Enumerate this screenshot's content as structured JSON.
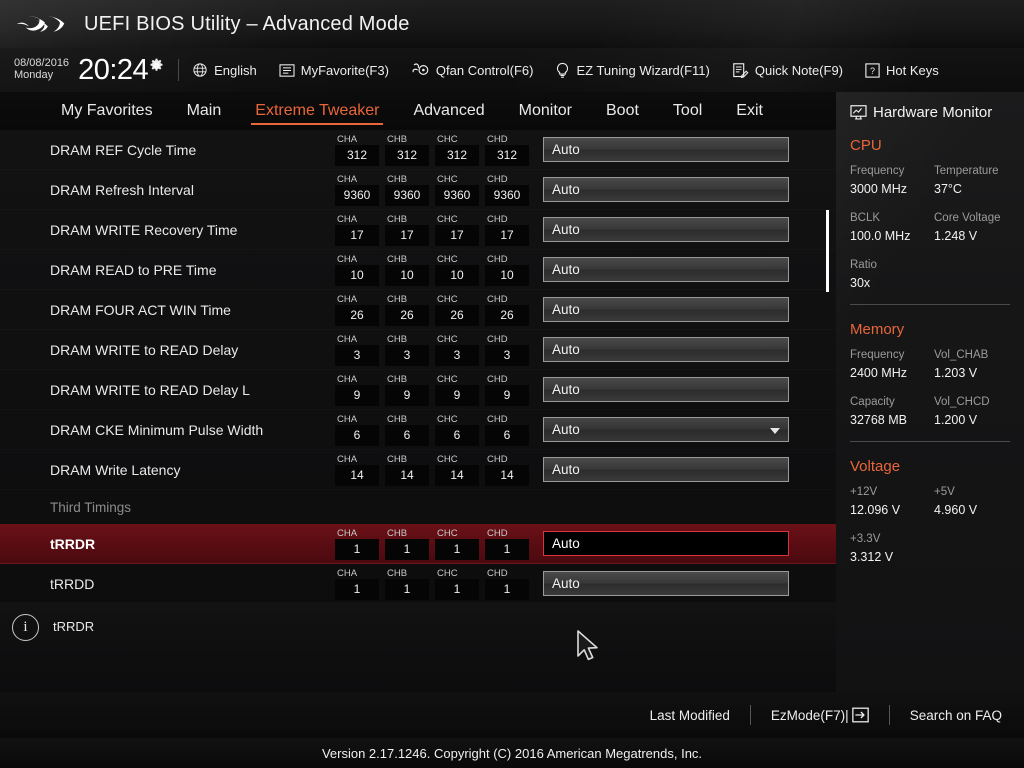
{
  "titlebar": {
    "logo_icon": "rog-logo",
    "title": "UEFI BIOS Utility – Advanced Mode"
  },
  "toolbar": {
    "date": "08/08/2016",
    "weekday": "Monday",
    "time": "20:24",
    "gear_icon": "gear-icon",
    "items": [
      {
        "icon": "globe-icon",
        "label": "English"
      },
      {
        "icon": "list-icon",
        "label": "MyFavorite(F3)"
      },
      {
        "icon": "fan-icon",
        "label": "Qfan Control(F6)"
      },
      {
        "icon": "bulb-icon",
        "label": "EZ Tuning Wizard(F11)"
      },
      {
        "icon": "note-icon",
        "label": "Quick Note(F9)"
      },
      {
        "icon": "question-icon",
        "label": "Hot Keys"
      }
    ]
  },
  "tabs": [
    {
      "label": "My Favorites",
      "active": false
    },
    {
      "label": "Main",
      "active": false
    },
    {
      "label": "Extreme Tweaker",
      "active": true
    },
    {
      "label": "Advanced",
      "active": false
    },
    {
      "label": "Monitor",
      "active": false
    },
    {
      "label": "Boot",
      "active": false
    },
    {
      "label": "Tool",
      "active": false
    },
    {
      "label": "Exit",
      "active": false
    }
  ],
  "channel_headers": [
    "CHA",
    "CHB",
    "CHC",
    "CHD"
  ],
  "settings": [
    {
      "type": "setting",
      "label": "DRAM REF Cycle Time",
      "channels": [
        "312",
        "312",
        "312",
        "312"
      ],
      "value": "Auto",
      "control": "text",
      "selected": false
    },
    {
      "type": "setting",
      "label": "DRAM Refresh Interval",
      "channels": [
        "9360",
        "9360",
        "9360",
        "9360"
      ],
      "value": "Auto",
      "control": "text",
      "selected": false
    },
    {
      "type": "setting",
      "label": "DRAM WRITE Recovery Time",
      "channels": [
        "17",
        "17",
        "17",
        "17"
      ],
      "value": "Auto",
      "control": "text",
      "selected": false
    },
    {
      "type": "setting",
      "label": "DRAM READ to PRE Time",
      "channels": [
        "10",
        "10",
        "10",
        "10"
      ],
      "value": "Auto",
      "control": "text",
      "selected": false
    },
    {
      "type": "setting",
      "label": "DRAM FOUR ACT WIN Time",
      "channels": [
        "26",
        "26",
        "26",
        "26"
      ],
      "value": "Auto",
      "control": "text",
      "selected": false
    },
    {
      "type": "setting",
      "label": "DRAM WRITE to READ Delay",
      "channels": [
        "3",
        "3",
        "3",
        "3"
      ],
      "value": "Auto",
      "control": "text",
      "selected": false
    },
    {
      "type": "setting",
      "label": "DRAM WRITE to READ Delay L",
      "channels": [
        "9",
        "9",
        "9",
        "9"
      ],
      "value": "Auto",
      "control": "text",
      "selected": false
    },
    {
      "type": "setting",
      "label": "DRAM CKE Minimum Pulse Width",
      "channels": [
        "6",
        "6",
        "6",
        "6"
      ],
      "value": "Auto",
      "control": "dropdown",
      "selected": false
    },
    {
      "type": "setting",
      "label": "DRAM Write Latency",
      "channels": [
        "14",
        "14",
        "14",
        "14"
      ],
      "value": "Auto",
      "control": "text",
      "selected": false
    },
    {
      "type": "section",
      "label": "Third Timings"
    },
    {
      "type": "setting",
      "label": "tRRDR",
      "channels": [
        "1",
        "1",
        "1",
        "1"
      ],
      "value": "Auto",
      "control": "text",
      "selected": true
    },
    {
      "type": "setting",
      "label": "tRRDD",
      "channels": [
        "1",
        "1",
        "1",
        "1"
      ],
      "value": "Auto",
      "control": "text",
      "selected": false
    }
  ],
  "hardware_monitor": {
    "title": "Hardware Monitor",
    "title_icon": "monitor-icon",
    "sections": [
      {
        "name": "CPU",
        "rows": [
          [
            {
              "key": "Frequency",
              "value": "3000 MHz"
            },
            {
              "key": "Temperature",
              "value": "37°C"
            }
          ],
          [
            {
              "key": "BCLK",
              "value": "100.0 MHz"
            },
            {
              "key": "Core Voltage",
              "value": "1.248 V"
            }
          ],
          [
            {
              "key": "Ratio",
              "value": "30x"
            }
          ]
        ]
      },
      {
        "name": "Memory",
        "rows": [
          [
            {
              "key": "Frequency",
              "value": "2400 MHz"
            },
            {
              "key": "Vol_CHAB",
              "value": "1.203 V"
            }
          ],
          [
            {
              "key": "Capacity",
              "value": "32768 MB"
            },
            {
              "key": "Vol_CHCD",
              "value": "1.200 V"
            }
          ]
        ]
      },
      {
        "name": "Voltage",
        "rows": [
          [
            {
              "key": "+12V",
              "value": "12.096 V"
            },
            {
              "key": "+5V",
              "value": "4.960 V"
            }
          ],
          [
            {
              "key": "+3.3V",
              "value": "3.312 V"
            }
          ]
        ]
      }
    ]
  },
  "info_bar": {
    "icon": "info-icon",
    "text": "tRRDR"
  },
  "footer": {
    "last_modified": "Last Modified",
    "ez_mode": "EzMode(F7)|",
    "ez_mode_icon": "arrow-exit-icon",
    "search_faq": "Search on FAQ"
  },
  "version": "Version 2.17.1246. Copyright (C) 2016 American Megatrends, Inc.",
  "colors": {
    "accent": "#e8663a",
    "selected_row": "#6b1117",
    "selected_border": "#d8343c"
  }
}
